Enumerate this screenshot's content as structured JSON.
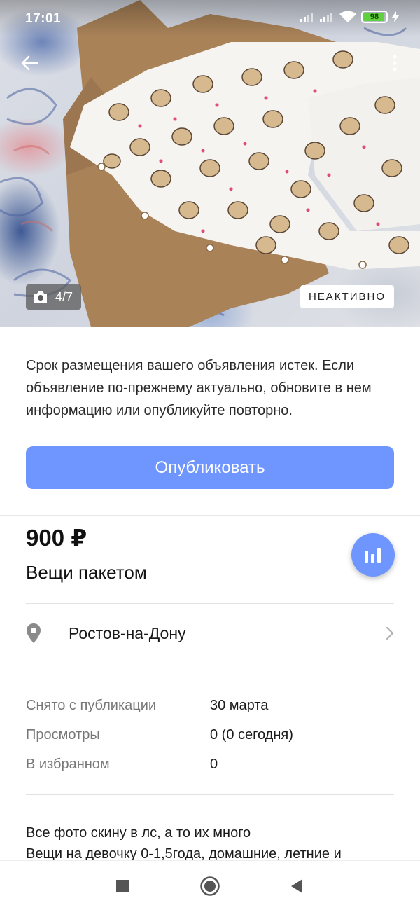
{
  "status_bar": {
    "time": "17:01",
    "battery_level": "98",
    "icons": [
      "cell-signal-icon",
      "cell-signal-icon",
      "wifi-icon",
      "battery-icon",
      "charging-icon"
    ]
  },
  "gallery": {
    "counter": "4/7",
    "status_badge": "НЕАКТИВНО"
  },
  "notice": {
    "text": "Срок размещения вашего объявления истек. Если объявление по-прежнему актуально, обновите в нем информацию или опубликуйте повторно."
  },
  "actions": {
    "publish_label": "Опубликовать"
  },
  "listing": {
    "price": "900 ₽",
    "title": "Вещи пакетом",
    "location": "Ростов-на-Дону"
  },
  "info": [
    {
      "label": "Снято с публикации",
      "value": "30 марта"
    },
    {
      "label": "Просмотры",
      "value": "0 (0 сегодня)"
    },
    {
      "label": "В избранном",
      "value": "0"
    }
  ],
  "description": {
    "line1": "Все фото скину в лс, а то их много",
    "line2": "Вещи на девочку 0-1,5года, домашние, летние и"
  },
  "colors": {
    "accent": "#6f95ff",
    "badge_bg": "#ffffff",
    "battery": "#5fd13f"
  }
}
